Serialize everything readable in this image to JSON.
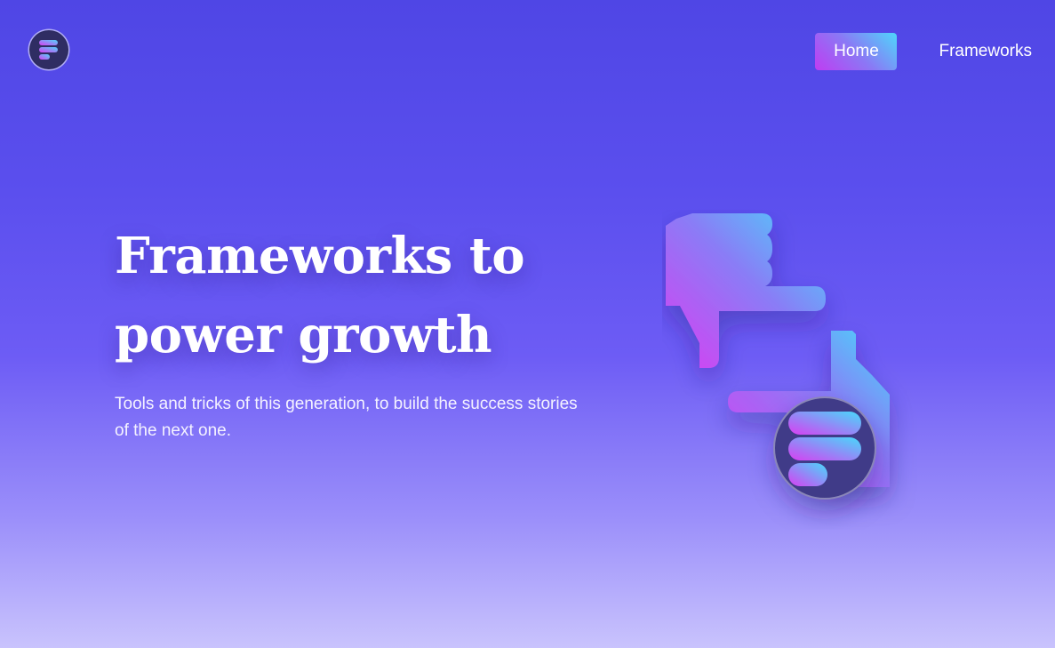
{
  "nav": {
    "logo": "frameworks-logo-icon",
    "items": [
      {
        "label": "Home",
        "active": true
      },
      {
        "label": "Frameworks",
        "active": false
      }
    ]
  },
  "hero": {
    "title_line1": "Frameworks to",
    "title_line2": "power growth",
    "subtitle_line1": "Tools and tricks of this generation, to build the success stories",
    "subtitle_line2": "of the next one.",
    "illustration": "framing-hands-icon"
  },
  "colors": {
    "background_top": "#4f46e5",
    "background_bottom": "#c9c3fd",
    "accent_pink": "#d93ef2",
    "accent_cyan": "#4fd6fb"
  }
}
